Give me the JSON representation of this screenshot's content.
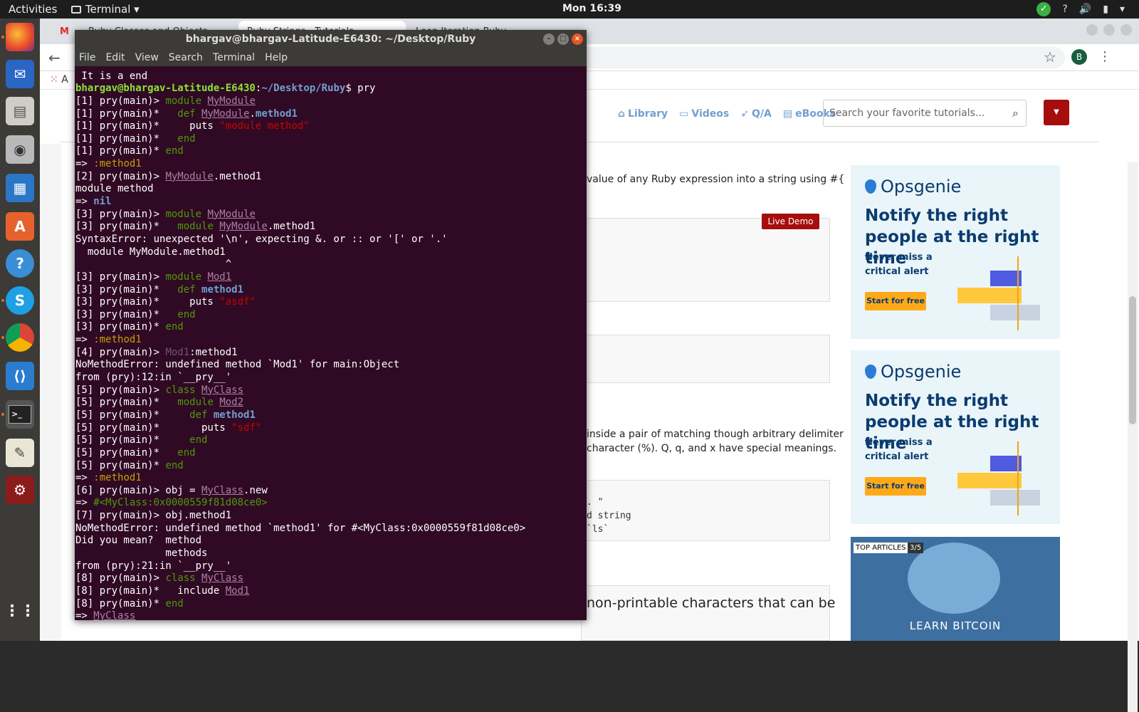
{
  "topbar": {
    "activities": "Activities",
    "app_name": "Terminal",
    "clock": "Mon 16:39"
  },
  "browser": {
    "tabs": [
      {
        "label": ""
      },
      {
        "label": "Ruby Classes and Objects"
      },
      {
        "label": "Ruby Strings - Tutorials"
      },
      {
        "label": "Loop Iteration Ruby"
      }
    ],
    "avatar_letter": "B",
    "bookmarks_apps": "A"
  },
  "site": {
    "nav": {
      "library": "Library",
      "videos": "Videos",
      "qa": "Q/A",
      "ebooks": "eBooks"
    },
    "search_placeholder": "Search your favorite tutorials...",
    "para1": "value of any Ruby expression into a string using #{",
    "live_demo": "Live Demo",
    "para2": "inside a pair of matching though arbitrary delimiter",
    "para3": "character (%). Q, q, and x have special meanings.",
    "code_line1": ". \"",
    "code_line2": "d string",
    "code_line3": "`ls`",
    "para4": "non-printable characters that can be"
  },
  "ads": [
    {
      "brand": "Opsgenie",
      "headline": "Notify the right people at the right time",
      "sub": "Never miss a critical alert",
      "cta": "Start for free"
    },
    {
      "brand": "Opsgenie",
      "headline": "Notify the right people at the right time",
      "sub": "Never miss a critical alert",
      "cta": "Start for free"
    }
  ],
  "ad3": {
    "label": "TOP ARTICLES",
    "count": "3/5",
    "text": "LEARN BITCOIN"
  },
  "terminal": {
    "title": "bhargav@bhargav-Latitude-E6430: ~/Desktop/Ruby",
    "menu": [
      "File",
      "Edit",
      "View",
      "Search",
      "Terminal",
      "Help"
    ]
  },
  "colors": {
    "terminal_bg": "#300a24",
    "accent_red": "#a60d0d",
    "ubuntu_orange": "#e95420",
    "ad_navy": "#0b3b70",
    "ad_orange": "#ffa919"
  }
}
